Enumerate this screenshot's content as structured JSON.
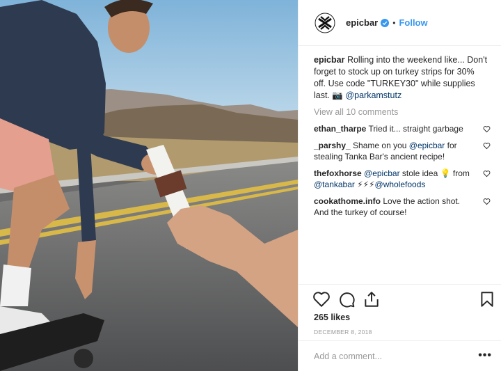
{
  "post": {
    "username": "epicbar",
    "follow_label": "Follow",
    "separator": "•",
    "caption": {
      "username": "epicbar",
      "text": " Rolling into the weekend like... Don't forget to stock up on turkey strips for 30% off. Use code \"TURKEY30\" while supplies last. 📷 ",
      "mention": "@parkamstutz"
    },
    "view_all_comments": "View all 10 comments",
    "comments": [
      {
        "user": "ethan_tharpe",
        "parts": [
          {
            "t": " Tried it... straight garbage",
            "m": false
          }
        ]
      },
      {
        "user": "_parshy_",
        "parts": [
          {
            "t": " Shame on you ",
            "m": false
          },
          {
            "t": "@epicbar",
            "m": true
          },
          {
            "t": " for stealing Tanka Bar's ancient recipe!",
            "m": false
          }
        ]
      },
      {
        "user": "thefoxhorse",
        "parts": [
          {
            "t": " ",
            "m": false
          },
          {
            "t": "@epicbar",
            "m": true
          },
          {
            "t": " stole idea 💡 from ",
            "m": false
          },
          {
            "t": "@tankabar",
            "m": true
          },
          {
            "t": " ⚡⚡⚡",
            "m": false
          },
          {
            "t": "@wholefoods",
            "m": true
          }
        ]
      },
      {
        "user": "cookathome.info",
        "parts": [
          {
            "t": " Love the action shot. And the turkey of course!",
            "m": false
          }
        ]
      }
    ],
    "likes": "265 likes",
    "date": "DECEMBER 8, 2018",
    "add_comment_placeholder": "Add a comment...",
    "more_label": "•••"
  },
  "colors": {
    "link": "#3897f0",
    "mention": "#003569",
    "muted": "#999999",
    "verified": "#3897f0"
  },
  "icons": [
    "epicbar-logo-icon",
    "verified-badge-icon",
    "heart-icon",
    "comment-icon",
    "share-icon",
    "bookmark-icon"
  ]
}
